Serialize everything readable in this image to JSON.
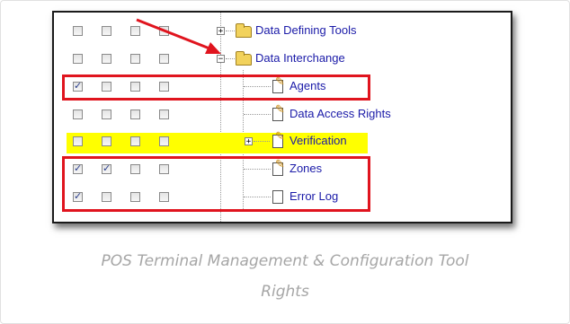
{
  "tree": {
    "rows": [
      {
        "label": "Data Defining Tools",
        "icon": "folder-icon",
        "expander": "+",
        "checks": [
          false,
          false,
          false,
          false
        ],
        "highlight": false
      },
      {
        "label": "Data Interchange",
        "icon": "folder-icon",
        "expander": "−",
        "checks": [
          false,
          false,
          false,
          false
        ],
        "highlight": false
      },
      {
        "label": "Agents",
        "icon": "editable-page-icon",
        "expander": "",
        "checks": [
          true,
          false,
          false,
          false
        ],
        "highlight": false
      },
      {
        "label": "Data Access Rights",
        "icon": "editable-page-icon",
        "expander": "",
        "checks": [
          false,
          false,
          false,
          false
        ],
        "highlight": false
      },
      {
        "label": "Verification",
        "icon": "editable-page-icon",
        "expander": "+",
        "checks": [
          false,
          false,
          false,
          false
        ],
        "highlight": true
      },
      {
        "label": "Zones",
        "icon": "editable-page-icon",
        "expander": "",
        "checks": [
          true,
          true,
          false,
          false
        ],
        "highlight": false
      },
      {
        "label": "Error Log",
        "icon": "page-icon",
        "expander": "",
        "checks": [
          true,
          false,
          false,
          false
        ],
        "highlight": false
      }
    ]
  },
  "colors": {
    "annotation": "#e0141e",
    "highlight": "#ffff00",
    "link": "#1a1aa8"
  },
  "caption": {
    "line1": "POS Terminal Management & Configuration Tool",
    "line2": "Rights"
  }
}
